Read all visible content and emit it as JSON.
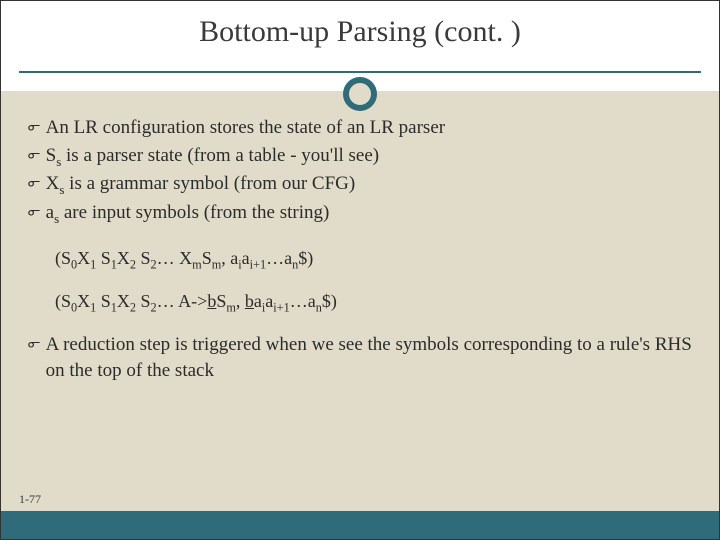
{
  "title": "Bottom-up Parsing (cont. )",
  "bullets": {
    "b1": "An LR configuration stores the state of an LR parser",
    "b2_pre": "S",
    "b2_sub": "s",
    "b2_post": " is a parser state (from a table - you'll see)",
    "b3_pre": "X",
    "b3_sub": "s",
    "b3_post": " is a grammar symbol (from our CFG)",
    "b4_pre": "a",
    "b4_sub": "s",
    "b4_post": " are input symbols (from the string)",
    "b5": "A reduction step is triggered when we see the symbols corresponding to a rule's RHS on the top of the stack"
  },
  "config1": {
    "open": "(S",
    "s0": "0",
    "x1": "X",
    "x1s": "1",
    "sp1": " S",
    "s1": "1",
    "x2": "X",
    "x2s": "2",
    "sp2": " S",
    "s2": "2",
    "dots1": "… X",
    "m": "m",
    "sm": "S",
    "m2": "m",
    "comma": ", a",
    "i": "i",
    "a2": "a",
    "ip1": "i+1",
    "dots2": "…a",
    "n": "n",
    "end": "$)"
  },
  "config2": {
    "open": "(S",
    "s0": "0",
    "x1": "X",
    "x1s": "1",
    "sp1": " S",
    "s1": "1",
    "x2": "X",
    "x2s": "2",
    "sp2": " S",
    "s2": "2",
    "dots1": "… A->",
    "bu": "b",
    "sm": "S",
    "m2": "m",
    "comma": ", ",
    "bu2": "b",
    "a1": "a",
    "i": "i",
    "a2": "a",
    "ip1": "i+1",
    "dots2": "…a",
    "n": "n",
    "end": "$)"
  },
  "page_number": "1-77",
  "bullet_mark": "൳"
}
